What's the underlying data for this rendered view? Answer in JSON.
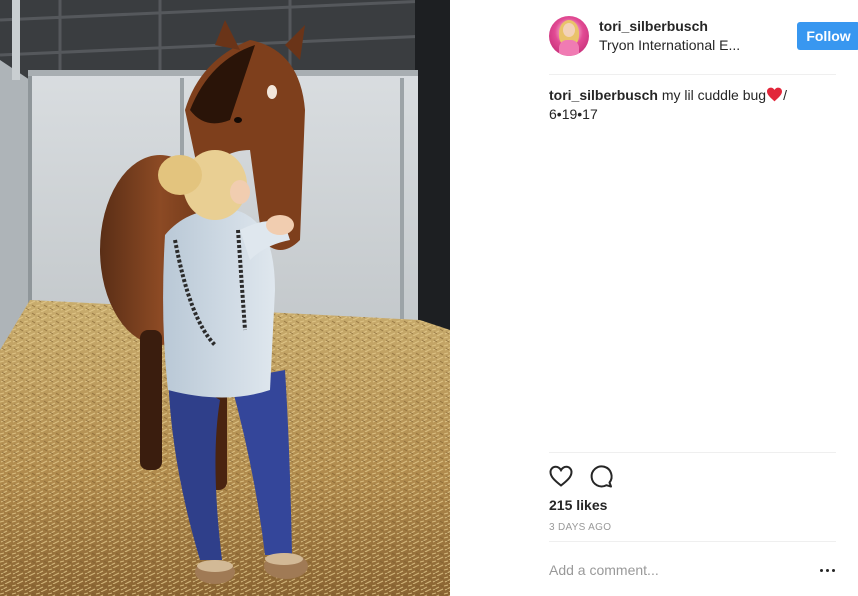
{
  "post": {
    "photo": {
      "icon": "photo-woman-kissing-horse"
    },
    "header": {
      "username": "tori_silberbusch",
      "location": "Tryon International E...",
      "follow_label": "Follow",
      "follow_color": "#3897f0"
    },
    "caption": {
      "username": "tori_silberbusch",
      "text": "my lil cuddle bug",
      "emoji": "red-heart-icon",
      "suffix": "/",
      "line2": "6•19•17"
    },
    "actions": {
      "like_icon": "heart-icon",
      "comment_icon": "comment-icon"
    },
    "likes": "215 likes",
    "timestamp": "3 DAYS AGO",
    "comment_placeholder": "Add a comment...",
    "more_icon": "more-options-icon"
  }
}
